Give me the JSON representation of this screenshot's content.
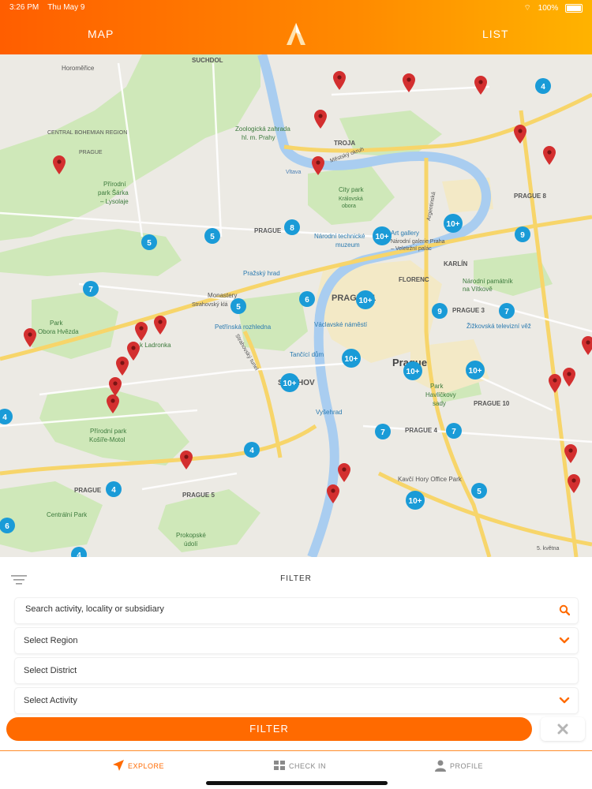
{
  "status_bar": {
    "time": "3:26 PM",
    "date": "Thu May 9",
    "battery": "100%"
  },
  "header": {
    "map_tab": "MAP",
    "list_tab": "LIST",
    "logo_icon": "app-logo-icon"
  },
  "map": {
    "labels": {
      "suchdol": "SUCHDOL",
      "horomerice": "Horoměřice",
      "central_bohemian": "CENTRAL BOHEMIAN REGION",
      "prague_nw": "PRAGUE",
      "zoo": "Zoologická zahrada",
      "zoo2": "hl. m. Prahy",
      "troja": "TROJA",
      "vltava": "Vltava",
      "mestsky": "Městský okruh",
      "sarka": "Přírodní",
      "sarka2": "park Šárka",
      "sarka3": "– Lysolaje",
      "citypark": "City park",
      "citypark2": "Královská",
      "citypark3": "obora",
      "prague_center": "PRAGUE",
      "narodni_tech": "Národní technické",
      "narodni_tech2": "muzeum",
      "art_gallery": "Art gallery",
      "art_gallery2": "Národní galerie Praha",
      "art_gallery3": "– Veletržní palác",
      "prague8": "PRAGUE 8",
      "karlin": "KARLÍN",
      "florenc": "FLORENC",
      "prazsky_hrad": "Pražský hrad",
      "monastery": "Monastery",
      "monastery2": "Strahovský klá",
      "prague1": "PRAGUE 1",
      "narodni_pamatnik": "Národní památník",
      "narodni_pamatnik2": "na Vítkově",
      "prague3": "PRAGUE 3",
      "zizkov": "Žižkovská televizní věž",
      "park_hvezda": "Park",
      "park_hvezda2": "Obora Hvězda",
      "ladronka": "k Ladronka",
      "petrinska": "Petřínská rozhledna",
      "vaclavske": "Václavské náměstí",
      "tancici": "Tančící dům",
      "prague_city": "Prague",
      "smichov": "SMÍCHOV",
      "havlickovy": "Park",
      "havlickovy2": "Havlíčkovy",
      "havlickovy3": "sady",
      "prague10": "PRAGUE 10",
      "vysehrad": "Vyšehrad",
      "prague4": "PRAGUE 4",
      "kosire": "Přírodní park",
      "kosire2": "Košíře-Motol",
      "kavci": "Kavčí Hory Office Park",
      "prague5": "PRAGUE 5",
      "prague_w": "PRAGUE",
      "centralni": "Centrální Park",
      "prokopske": "Prokopské",
      "prokopske2": "údolí",
      "strahovsky_tunel": "Strahovský tunel",
      "argentinska": "Argentinská",
      "petvetna": "5. května"
    },
    "clusters": [
      "4",
      "5",
      "5",
      "8",
      "10+",
      "10+",
      "9",
      "7",
      "6",
      "5",
      "10+",
      "7",
      "9",
      "10+",
      "10+",
      "10+",
      "10+",
      "7",
      "7",
      "4",
      "4",
      "5",
      "10+",
      "6",
      "4",
      "4"
    ]
  },
  "filter": {
    "title": "FILTER",
    "search_placeholder": "Search activity, locality or subsidiary",
    "region": "Select Region",
    "district": "Select District",
    "activity": "Select Activity",
    "button": "FILTER"
  },
  "tabbar": {
    "explore": "EXPLORE",
    "checkin": "CHECK IN",
    "profile": "PROFILE"
  },
  "colors": {
    "accent": "#ff6a00",
    "pin": "#d32f2f",
    "cluster": "#1a9bd7"
  }
}
